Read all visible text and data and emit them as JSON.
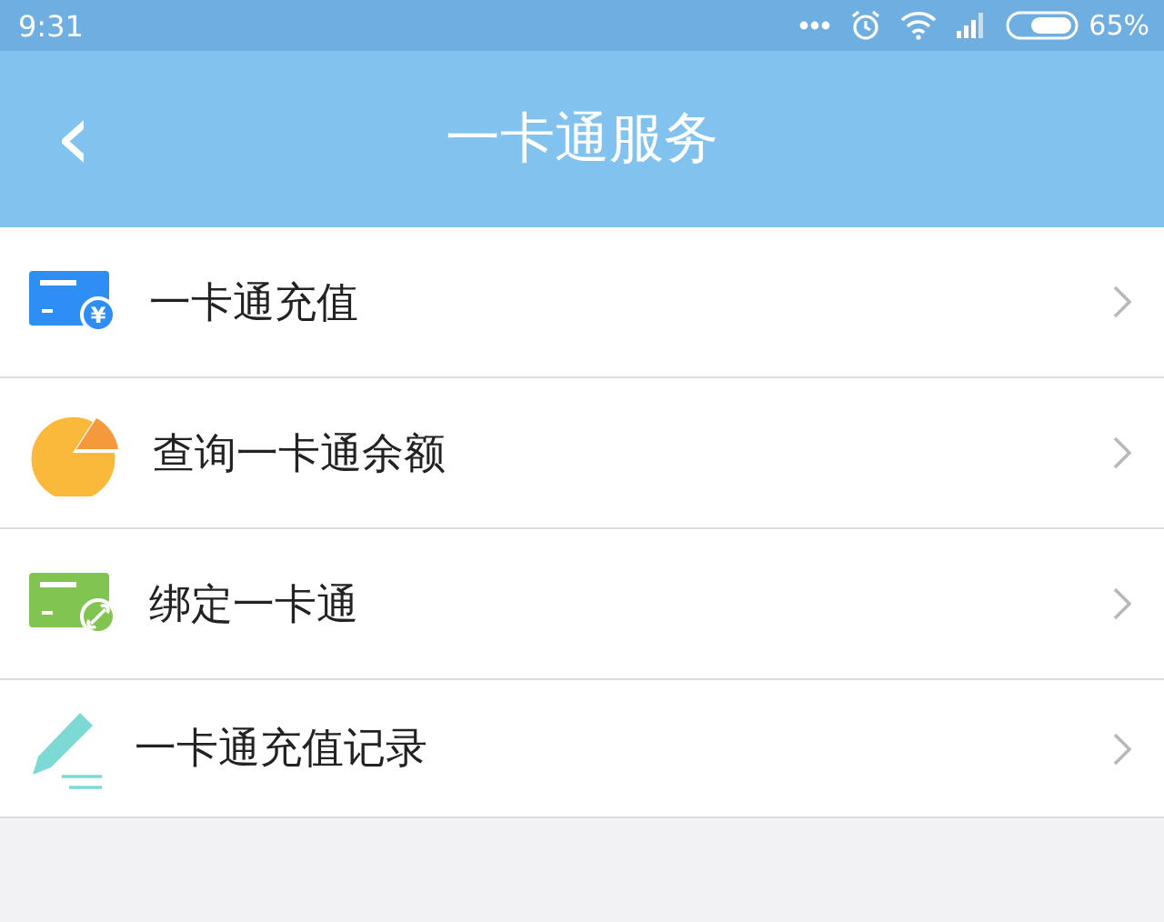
{
  "status_bar": {
    "time": "9:31",
    "battery": "65%"
  },
  "header": {
    "back": "‹",
    "title": "一卡通服务"
  },
  "items": [
    {
      "kind": "card_yen",
      "label": "一卡通充值",
      "symbol": "¥"
    },
    {
      "kind": "pie",
      "label": "查询一卡通余额"
    },
    {
      "kind": "card_link",
      "label": "绑定一卡通"
    },
    {
      "kind": "pencil",
      "label": "一卡通充值记录"
    }
  ]
}
